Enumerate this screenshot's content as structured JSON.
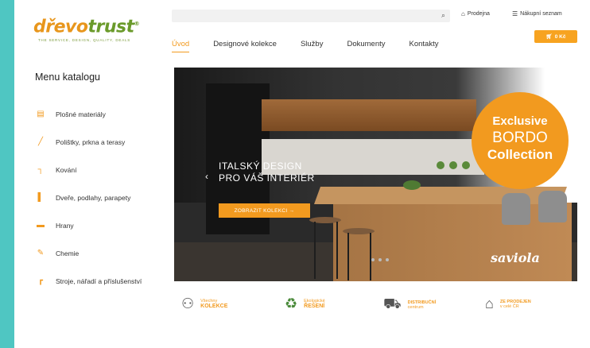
{
  "logo": {
    "part1": "dřevo",
    "part2": "trust",
    "mark": "®",
    "tagline": "THE SERVICE, DESIGN, QUALITY, DEALS"
  },
  "search": {
    "icon": "search-icon"
  },
  "top_links": [
    {
      "label": "Prodejna",
      "icon": "home-icon"
    },
    {
      "label": "Nákupní seznam",
      "icon": "list-icon"
    }
  ],
  "nav": [
    {
      "label": "Úvod",
      "active": true
    },
    {
      "label": "Designové kolekce"
    },
    {
      "label": "Služby"
    },
    {
      "label": "Dokumenty"
    },
    {
      "label": "Kontakty"
    }
  ],
  "cart": {
    "label": "0 Kč"
  },
  "menu": {
    "title": "Menu katalogu",
    "items": [
      {
        "label": "Plošné materiály",
        "icon": "sheet-icon"
      },
      {
        "label": "Polištky, prkna a terasy",
        "icon": "plank-icon"
      },
      {
        "label": "Kování",
        "icon": "hardware-icon"
      },
      {
        "label": "Dveře, podlahy, parapety",
        "icon": "door-icon"
      },
      {
        "label": "Hrany",
        "icon": "edge-icon"
      },
      {
        "label": "Chemie",
        "icon": "chemistry-icon"
      },
      {
        "label": "Stroje, nářadí a příslušenství",
        "icon": "tools-icon"
      }
    ]
  },
  "hero": {
    "title_line1": "ITALSKÝ DESIGN",
    "title_line2": "PRO VÁŠ INTERIÉR",
    "cta": "ZOBRAZIT KOLEKCI →",
    "badge": {
      "line1": "Exclusive",
      "line2": "BORDO",
      "line3": "Collection"
    },
    "brand": "saviola",
    "prev_arrow": "‹"
  },
  "features": [
    {
      "t1": "Všechny",
      "t2": "KOLEKCE",
      "icon": "users-icon"
    },
    {
      "t1": "Ekologické",
      "t2": "ŘEŠENÍ",
      "icon": "recycle-icon"
    },
    {
      "t1": "DISTRIBUČNÍ",
      "t2": "centrum",
      "icon": "truck-icon"
    },
    {
      "t1": "ZE PRODEJEN",
      "t2": "v celé ČR",
      "icon": "house-icon"
    }
  ]
}
